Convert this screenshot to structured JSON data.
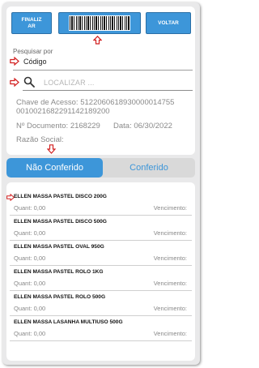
{
  "toolbar": {
    "finalizar_label": "FINALIZ\nAR",
    "barcode_icon": "barcode-icon",
    "voltar_label": "VOLTAR"
  },
  "search_field": {
    "label": "Pesquisar por",
    "value": "Código"
  },
  "locate": {
    "placeholder": "LOCALIZAR ..."
  },
  "document": {
    "chave_line1": "Chave de Acesso: 5122060618930000014755",
    "chave_line2": "0010021682291142189200",
    "numero_line": "Nº Documento: 2168229",
    "data_line": "Data: 06/30/2022",
    "razao_line": "Razão Social:"
  },
  "tabs": {
    "not_checked": "Não Conferido",
    "checked": "Conferido"
  },
  "list": {
    "qty_label": "Quant: 0,00",
    "venc_label": "Vencimento:",
    "items": [
      "ELLEN MASSA PASTEL DISCO 200G",
      "ELLEN MASSA PASTEL DISCO 500G",
      "ELLEN MASSA PASTEL OVAL 950G",
      "ELLEN MASSA PASTEL ROLO 1KG",
      "ELLEN MASSA PASTEL ROLO 500G",
      "ELLEN MASSA LASANHA MULTIUSO 500G"
    ]
  },
  "colors": {
    "accent": "#3d96d9",
    "annotation_arrow": "#d21f1f"
  }
}
